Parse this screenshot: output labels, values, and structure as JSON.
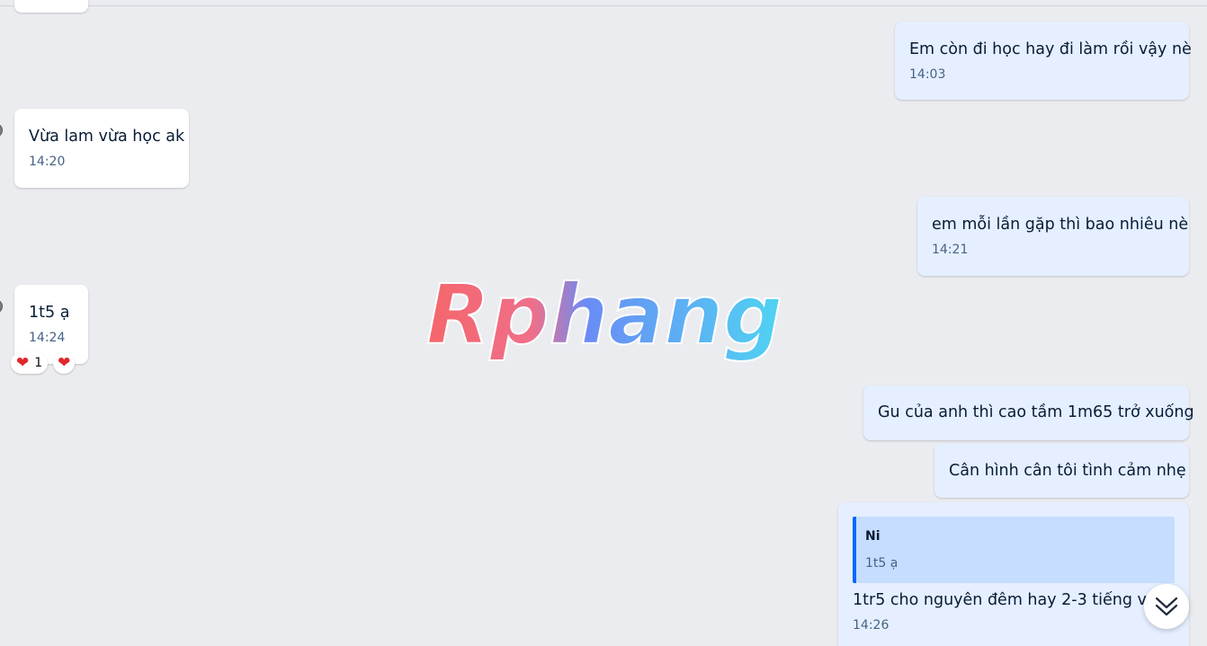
{
  "messages": [
    {
      "id": "m1",
      "direction": "out",
      "text": "Em còn đi học hay đi làm rồi vậy nè",
      "time": "14:03"
    },
    {
      "id": "m2",
      "direction": "in",
      "text": "Vừa lam vừa học ak",
      "time": "14:20"
    },
    {
      "id": "m3",
      "direction": "out",
      "text": "em mỗi lần gặp thì bao nhiêu nè",
      "time": "14:21"
    },
    {
      "id": "m4",
      "direction": "in",
      "text": "1t5 ạ",
      "time": "14:24",
      "reactions": [
        {
          "emoji": "heart",
          "count": "1"
        },
        {
          "emoji": "heart"
        }
      ]
    },
    {
      "id": "m5",
      "direction": "out",
      "text": "Gu của anh thì cao tầm 1m65 trở xuống"
    },
    {
      "id": "m6",
      "direction": "out",
      "text": "Cân hình cân tôi tình cảm nhẹ"
    },
    {
      "id": "m7",
      "direction": "out",
      "text": "1tr5 cho nguyên đêm hay 2-3 tiếng vậy",
      "time": "14:26",
      "quote": {
        "name": "Ni",
        "text": "1t5 ạ"
      }
    }
  ],
  "watermark": {
    "text": "Rphang"
  },
  "icons": {
    "scroll_down": "chevron-double-down-icon",
    "reaction": "heart-icon"
  },
  "colors": {
    "background": "#ebecf0",
    "incoming_bubble": "#ffffff",
    "outgoing_bubble": "#e5efff",
    "quote_bar": "#0068ff",
    "quote_bg": "#c6ddff",
    "time_text": "#476285",
    "heart": "#e1272c"
  }
}
